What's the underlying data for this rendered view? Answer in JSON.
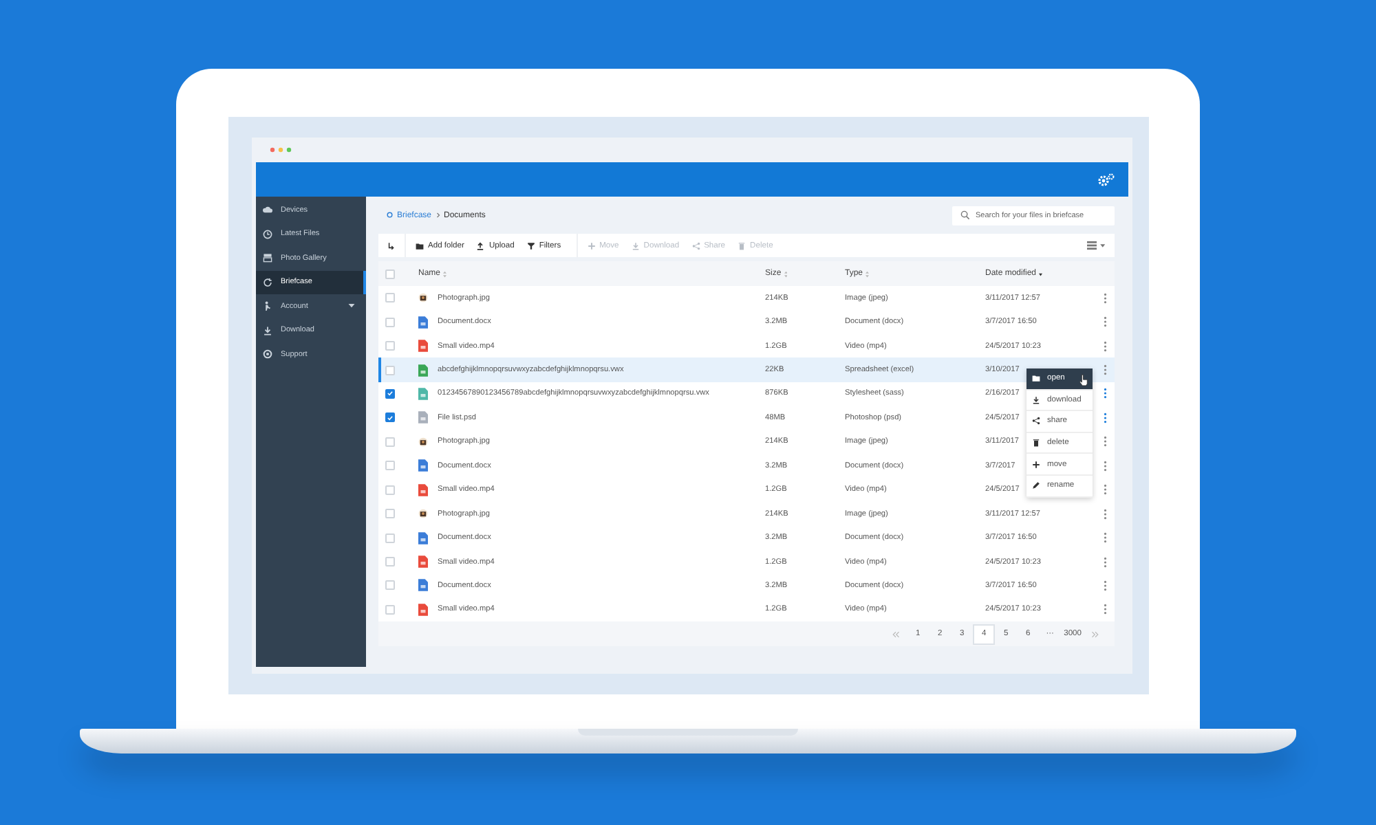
{
  "sidebar": {
    "items": [
      {
        "kind": "cloud",
        "label": "Devices",
        "selected": false,
        "expandable": false
      },
      {
        "kind": "clock",
        "label": "Latest Files",
        "selected": false,
        "expandable": false
      },
      {
        "kind": "gallery",
        "label": "Photo Gallery",
        "selected": false,
        "expandable": false
      },
      {
        "kind": "sync",
        "label": "Briefcase",
        "selected": true,
        "expandable": false
      },
      {
        "kind": "person",
        "label": "Account",
        "selected": false,
        "expandable": true
      },
      {
        "kind": "download",
        "label": "Download",
        "selected": false,
        "expandable": false
      },
      {
        "kind": "support",
        "label": "Support",
        "selected": false,
        "expandable": false
      }
    ]
  },
  "breadcrumb": [
    {
      "label": "Briefcase",
      "current": false
    },
    {
      "label": "Documents",
      "current": true
    }
  ],
  "search": {
    "placeholder": "Search for your files in briefcase"
  },
  "toolbar": {
    "actions": [
      {
        "kind": "folder",
        "label": "Add folder",
        "disabled": false
      },
      {
        "kind": "upload",
        "label": "Upload",
        "disabled": false
      },
      {
        "kind": "filter",
        "label": "Filters",
        "disabled": false
      },
      {
        "kind": "move",
        "label": "Move",
        "disabled": true
      },
      {
        "kind": "download",
        "label": "Download",
        "disabled": true
      },
      {
        "kind": "share",
        "label": "Share",
        "disabled": true
      },
      {
        "kind": "trash",
        "label": "Delete",
        "disabled": true
      }
    ]
  },
  "table": {
    "select_all": {
      "checked": false
    },
    "columns": [
      {
        "label": "Name",
        "sorted": false
      },
      {
        "label": "Size",
        "sorted": false
      },
      {
        "label": "Type",
        "sorted": false
      },
      {
        "label": "Date modified",
        "sorted": true
      }
    ],
    "rows": [
      {
        "kind": "photo",
        "name": "Photograph.jpg",
        "size": "214KB",
        "type": "Image (jpeg)",
        "date": "3/11/2017 12:57",
        "checked": false,
        "highlighted": false
      },
      {
        "kind": "doc",
        "name": "Document.docx",
        "size": "3.2MB",
        "type": "Document (docx)",
        "date": "3/7/2017 16:50",
        "checked": false,
        "highlighted": false
      },
      {
        "kind": "video",
        "name": "Small video.mp4",
        "size": "1.2GB",
        "type": "Video (mp4)",
        "date": "24/5/2017 10:23",
        "checked": false,
        "highlighted": false
      },
      {
        "kind": "sheet",
        "name": "abcdefghijklmnopqrsuvwxyzabcdefghijklmnopqrsu.vwx",
        "size": "22KB",
        "type": "Spreadsheet (excel)",
        "date": "3/10/2017",
        "checked": false,
        "highlighted": true
      },
      {
        "kind": "style",
        "name": "01234567890123456789abcdefghijklmnopqrsuvwxyzabcdefghijklmnopqrsu.vwx",
        "size": "876KB",
        "type": "Stylesheet (sass)",
        "date": "2/16/2017",
        "checked": true,
        "highlighted": false
      },
      {
        "kind": "psd",
        "name": "File list.psd",
        "size": "48MB",
        "type": "Photoshop (psd)",
        "date": "24/5/2017",
        "checked": true,
        "highlighted": false
      },
      {
        "kind": "photo",
        "name": "Photograph.jpg",
        "size": "214KB",
        "type": "Image (jpeg)",
        "date": "3/11/2017",
        "checked": false,
        "highlighted": false
      },
      {
        "kind": "doc",
        "name": "Document.docx",
        "size": "3.2MB",
        "type": "Document (docx)",
        "date": "3/7/2017",
        "checked": false,
        "highlighted": false
      },
      {
        "kind": "video",
        "name": "Small video.mp4",
        "size": "1.2GB",
        "type": "Video (mp4)",
        "date": "24/5/2017",
        "checked": false,
        "highlighted": false
      },
      {
        "kind": "photo",
        "name": "Photograph.jpg",
        "size": "214KB",
        "type": "Image (jpeg)",
        "date": "3/11/2017 12:57",
        "checked": false,
        "highlighted": false
      },
      {
        "kind": "doc",
        "name": "Document.docx",
        "size": "3.2MB",
        "type": "Document (docx)",
        "date": "3/7/2017 16:50",
        "checked": false,
        "highlighted": false
      },
      {
        "kind": "video",
        "name": "Small video.mp4",
        "size": "1.2GB",
        "type": "Video (mp4)",
        "date": "24/5/2017 10:23",
        "checked": false,
        "highlighted": false
      },
      {
        "kind": "doc",
        "name": "Document.docx",
        "size": "3.2MB",
        "type": "Document (docx)",
        "date": "3/7/2017 16:50",
        "checked": false,
        "highlighted": false
      },
      {
        "kind": "video",
        "name": "Small video.mp4",
        "size": "1.2GB",
        "type": "Video (mp4)",
        "date": "24/5/2017 10:23",
        "checked": false,
        "highlighted": false
      }
    ]
  },
  "context_menu": {
    "items": [
      {
        "kind": "folder",
        "label": "open",
        "selected": true
      },
      {
        "kind": "download",
        "label": "download",
        "selected": false
      },
      {
        "kind": "share",
        "label": "share",
        "selected": false
      },
      {
        "kind": "trash",
        "label": "delete",
        "selected": false
      },
      {
        "kind": "move",
        "label": "move",
        "selected": false
      },
      {
        "kind": "pencil",
        "label": "rename",
        "selected": false
      }
    ]
  },
  "pagination": {
    "pages": [
      {
        "label": "1",
        "selected": false
      },
      {
        "label": "2",
        "selected": false
      },
      {
        "label": "3",
        "selected": false
      },
      {
        "label": "4",
        "selected": true
      },
      {
        "label": "5",
        "selected": false
      },
      {
        "label": "6",
        "selected": false
      },
      {
        "label": "···",
        "selected": false
      },
      {
        "label": "3000",
        "selected": false
      }
    ]
  }
}
